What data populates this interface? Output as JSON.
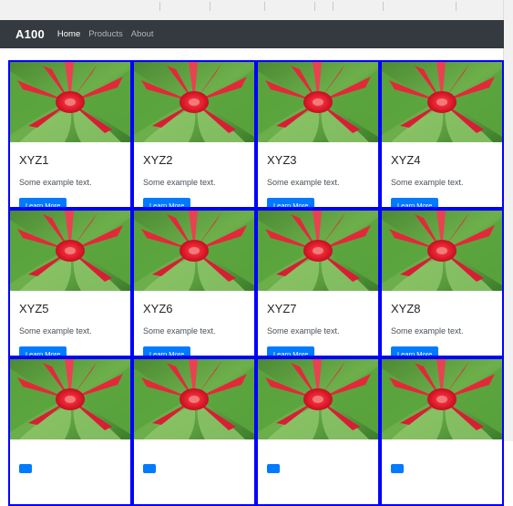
{
  "navbar": {
    "brand": "A100",
    "links": [
      "Home",
      "Products",
      "About"
    ]
  },
  "cards": [
    {
      "title": "XYZ1",
      "text": "Some example text.",
      "button": "Learn More"
    },
    {
      "title": "XYZ2",
      "text": "Some example text.",
      "button": "Learn More"
    },
    {
      "title": "XYZ3",
      "text": "Some example text.",
      "button": "Learn More"
    },
    {
      "title": "XYZ4",
      "text": "Some example text.",
      "button": "Learn More"
    },
    {
      "title": "XYZ5",
      "text": "Some example text.",
      "button": "Learn More"
    },
    {
      "title": "XYZ6",
      "text": "Some example text.",
      "button": "Learn More"
    },
    {
      "title": "XYZ7",
      "text": "Some example text.",
      "button": "Learn More"
    },
    {
      "title": "XYZ8",
      "text": "Some example text.",
      "button": "Learn More"
    },
    {
      "title": "",
      "text": "",
      "button": ""
    },
    {
      "title": "",
      "text": "",
      "button": ""
    },
    {
      "title": "",
      "text": "",
      "button": ""
    },
    {
      "title": "",
      "text": "",
      "button": ""
    }
  ],
  "colors": {
    "navbar_bg": "#343a40",
    "card_border": "#0000ff",
    "button_bg": "#007bff"
  }
}
